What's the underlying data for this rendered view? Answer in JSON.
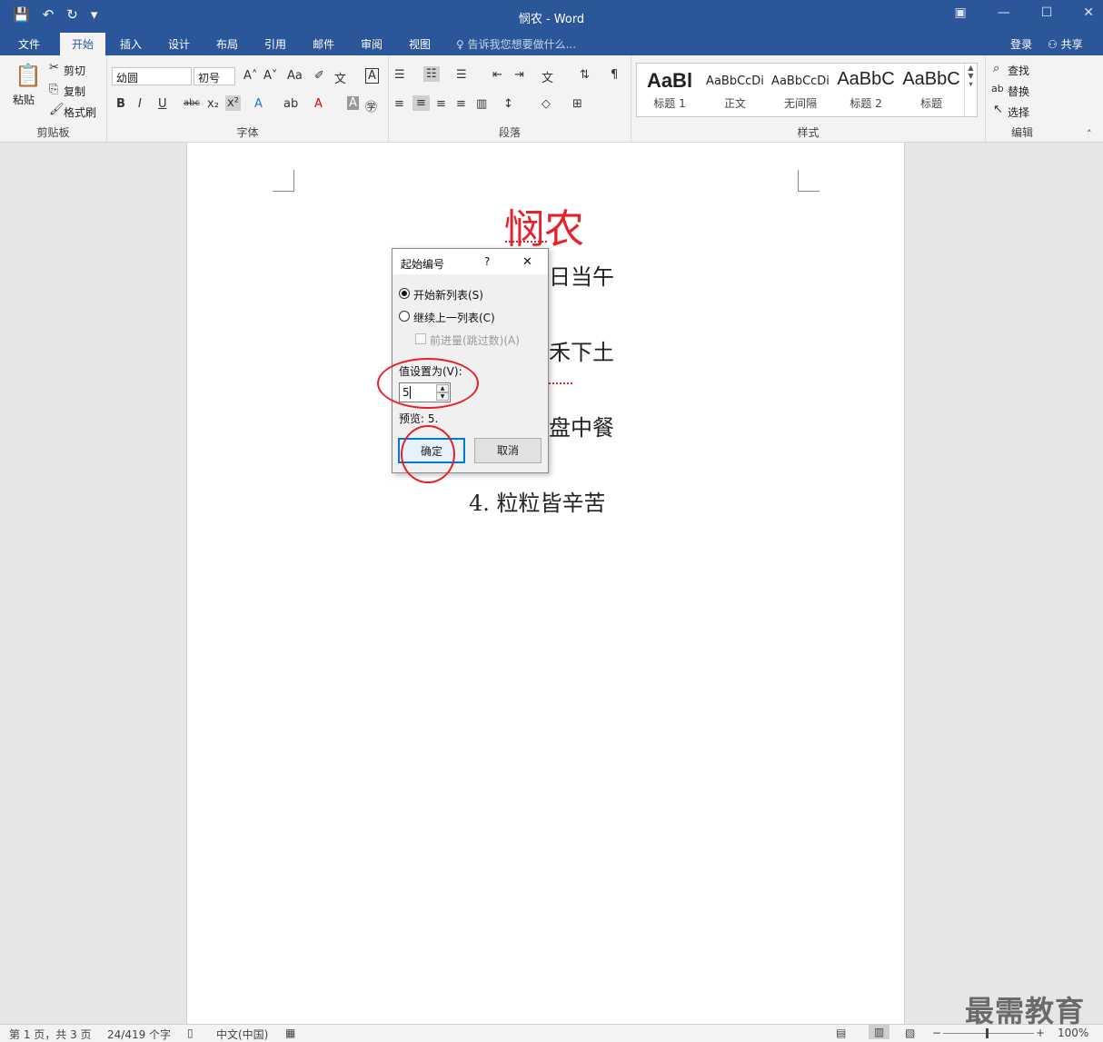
{
  "app": {
    "window_title": "悯农 - Word"
  },
  "qat": {
    "save": "💾",
    "undo": "↶",
    "redo": "↻",
    "customize": "▾"
  },
  "window_controls": {
    "ribbon_opts": "▣",
    "minimize": "—",
    "maximize": "☐",
    "close": "✕"
  },
  "tabs": [
    "文件",
    "开始",
    "插入",
    "设计",
    "布局",
    "引用",
    "邮件",
    "审阅",
    "视图"
  ],
  "tell_me": "告诉我您想要做什么...",
  "account": {
    "login": "登录",
    "share": "共享"
  },
  "ribbon": {
    "clipboard": {
      "paste": "粘贴",
      "cut": "剪切",
      "copy": "复制",
      "format_painter": "格式刷",
      "label": "剪贴板"
    },
    "font": {
      "name": "幼圆",
      "size": "初号",
      "label": "字体",
      "change_case": "Aa"
    },
    "paragraph": {
      "label": "段落"
    },
    "styles": {
      "items": [
        {
          "preview": "AaBl",
          "name": "标题 1"
        },
        {
          "preview": "AaBbCcDi",
          "name": "正文"
        },
        {
          "preview": "AaBbCcDi",
          "name": "无间隔"
        },
        {
          "preview": "AaBbC",
          "name": "标题 2"
        },
        {
          "preview": "AaBbC",
          "name": "标题"
        }
      ],
      "label": "样式"
    },
    "editing": {
      "find": "查找",
      "replace": "替换",
      "select": "选择",
      "label": "编辑"
    }
  },
  "document": {
    "title": "悯农",
    "lines": [
      "日当午",
      "禾下土",
      "盘中餐",
      "4. 粒粒皆辛苦"
    ]
  },
  "dialog": {
    "title": "起始编号",
    "help": "?",
    "close": "✕",
    "option_new_list": "开始新列表(S)",
    "option_continue": "继续上一列表(C)",
    "option_advance": "前进量(跳过数)(A)",
    "set_value_label": "值设置为(V):",
    "value": "5",
    "preview": "预览: 5.",
    "ok": "确定",
    "cancel": "取消"
  },
  "status": {
    "page": "第 1 页，共 3 页",
    "words": "24/419 个字",
    "language": "中文(中国)",
    "zoom": "100%"
  },
  "watermark": "最需教育"
}
